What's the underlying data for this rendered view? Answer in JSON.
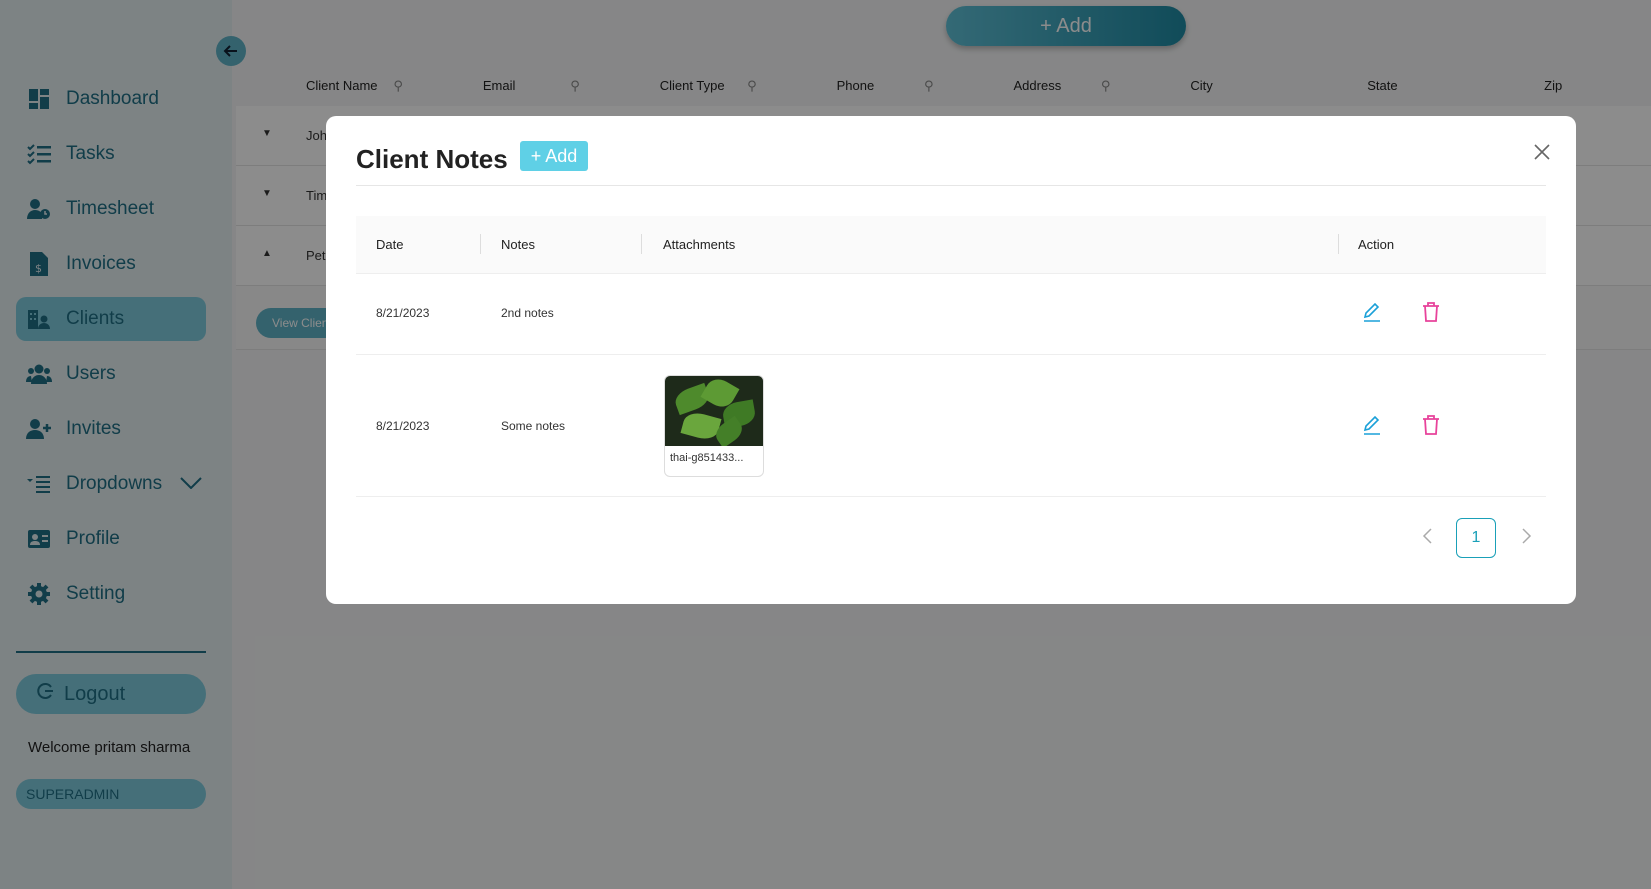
{
  "sidebar": {
    "items": [
      {
        "label": "Dashboard",
        "icon": "dashboard-icon"
      },
      {
        "label": "Tasks",
        "icon": "tasks-icon"
      },
      {
        "label": "Timesheet",
        "icon": "timesheet-icon"
      },
      {
        "label": "Invoices",
        "icon": "invoice-icon"
      },
      {
        "label": "Clients",
        "icon": "clients-icon",
        "active": true
      },
      {
        "label": "Users",
        "icon": "users-icon"
      },
      {
        "label": "Invites",
        "icon": "invite-icon"
      },
      {
        "label": "Dropdowns",
        "icon": "dropdowns-icon"
      },
      {
        "label": "Profile",
        "icon": "profile-icon"
      },
      {
        "label": "Setting",
        "icon": "gear-icon"
      }
    ],
    "logout_label": "Logout",
    "welcome": "Welcome pritam sharma",
    "role": "SUPERADMIN"
  },
  "main": {
    "add_label": "+ Add",
    "columns": [
      "Client Name",
      "Email",
      "Client Type",
      "Phone",
      "Address",
      "City",
      "State",
      "Zip"
    ],
    "rows": [
      {
        "arrow": "▼",
        "name": "Joh"
      },
      {
        "arrow": "▼",
        "name": "Tim"
      },
      {
        "arrow": "▲",
        "name": "Pete"
      }
    ],
    "view_clients_label": "View Clien"
  },
  "modal": {
    "title": "Client Notes",
    "add_label": "+ Add",
    "columns": {
      "date": "Date",
      "notes": "Notes",
      "attachments": "Attachments",
      "action": "Action"
    },
    "rows": [
      {
        "date": "8/21/2023",
        "notes": "2nd notes",
        "attachment": null
      },
      {
        "date": "8/21/2023",
        "notes": "Some notes",
        "attachment": "thai-g851433..."
      }
    ],
    "pagination": {
      "current": "1"
    }
  },
  "colors": {
    "accent": "#1f6f86",
    "teal": "#5fd0e6",
    "delete": "#e8439b",
    "edit": "#1aa0d8"
  }
}
